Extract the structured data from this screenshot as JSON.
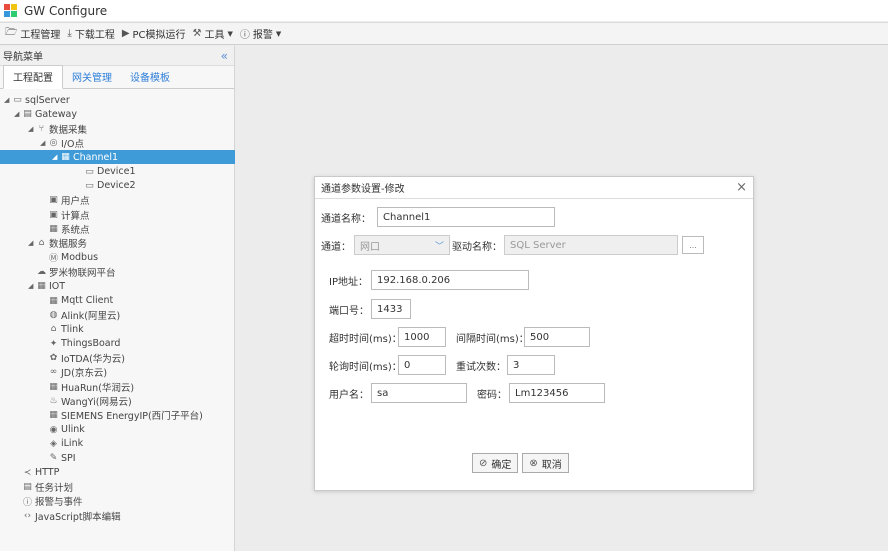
{
  "app": {
    "title": "GW Configure"
  },
  "toolbar": {
    "items": [
      {
        "label": "工程管理",
        "icon": "folder-icon"
      },
      {
        "label": "下载工程",
        "icon": "download-icon"
      },
      {
        "label": "PC模拟运行",
        "icon": "play-icon"
      },
      {
        "label": "工具",
        "icon": "wrench-icon"
      },
      {
        "label": "报警",
        "icon": "alarm-icon"
      }
    ]
  },
  "sidebar": {
    "title": "导航菜单",
    "collapse_glyph": "«",
    "tabs": [
      "工程配置",
      "网关管理",
      "设备模板"
    ],
    "active_tab": 0,
    "tree": [
      {
        "label": "sqlServer",
        "level": 0,
        "arrow": "◢",
        "icon": "monitor-icon"
      },
      {
        "label": "Gateway",
        "level": 1,
        "arrow": "◢",
        "icon": "gateway-icon"
      },
      {
        "label": "数据采集",
        "level": 2,
        "arrow": "◢",
        "icon": "collect-icon"
      },
      {
        "label": "I/O点",
        "level": 3,
        "arrow": "◢",
        "icon": "io-icon"
      },
      {
        "label": "Channel1",
        "level": 4,
        "arrow": "◢",
        "icon": "channel-icon",
        "selected": true
      },
      {
        "label": "Device1",
        "level": 5,
        "arrow": "",
        "icon": "device-icon"
      },
      {
        "label": "Device2",
        "level": 5,
        "arrow": "",
        "icon": "device-icon"
      },
      {
        "label": "用户点",
        "level": 3,
        "arrow": "",
        "icon": "user-point-icon"
      },
      {
        "label": "计算点",
        "level": 3,
        "arrow": "",
        "icon": "calc-point-icon"
      },
      {
        "label": "系统点",
        "level": 3,
        "arrow": "",
        "icon": "system-point-icon"
      },
      {
        "label": "数据服务",
        "level": 2,
        "arrow": "◢",
        "icon": "data-service-icon"
      },
      {
        "label": "Modbus",
        "level": 3,
        "arrow": "",
        "icon": "modbus-icon"
      },
      {
        "label": "罗米物联网平台",
        "level": 2,
        "arrow": "",
        "icon": "cloud-icon"
      },
      {
        "label": "IOT",
        "level": 2,
        "arrow": "◢",
        "icon": "iot-icon"
      },
      {
        "label": "Mqtt Client",
        "level": 3,
        "arrow": "",
        "icon": "mqtt-icon"
      },
      {
        "label": "Alink(阿里云)",
        "level": 3,
        "arrow": "",
        "icon": "alink-icon"
      },
      {
        "label": "Tlink",
        "level": 3,
        "arrow": "",
        "icon": "tlink-icon"
      },
      {
        "label": "ThingsBoard",
        "level": 3,
        "arrow": "",
        "icon": "thingsboard-icon"
      },
      {
        "label": "IoTDA(华为云)",
        "level": 3,
        "arrow": "",
        "icon": "iotda-icon"
      },
      {
        "label": "JD(京东云)",
        "level": 3,
        "arrow": "",
        "icon": "jd-icon"
      },
      {
        "label": "HuaRun(华润云)",
        "level": 3,
        "arrow": "",
        "icon": "huarun-icon"
      },
      {
        "label": "WangYi(网易云)",
        "level": 3,
        "arrow": "",
        "icon": "wangyi-icon"
      },
      {
        "label": "SIEMENS EnergyIP(西门子平台)",
        "level": 3,
        "arrow": "",
        "icon": "siemens-icon"
      },
      {
        "label": "Ulink",
        "level": 3,
        "arrow": "",
        "icon": "ulink-icon"
      },
      {
        "label": "iLink",
        "level": 3,
        "arrow": "",
        "icon": "ilink-icon"
      },
      {
        "label": "SPI",
        "level": 3,
        "arrow": "",
        "icon": "spi-icon"
      },
      {
        "label": "HTTP",
        "level": 1,
        "arrow": "",
        "icon": "share-icon"
      },
      {
        "label": "任务计划",
        "level": 1,
        "arrow": "",
        "icon": "task-icon"
      },
      {
        "label": "报警与事件",
        "level": 1,
        "arrow": "",
        "icon": "alarm-icon"
      },
      {
        "label": "JavaScript脚本编辑",
        "level": 1,
        "arrow": "",
        "icon": "code-icon"
      }
    ]
  },
  "dialog": {
    "title": "通道参数设置-修改",
    "close_glyph": "×",
    "channel_name_label": "通道名称：",
    "channel_name_value": "Channel1",
    "channel_label": "通道：",
    "channel_value": "网口",
    "driver_label": "驱动名称：",
    "driver_value": "SQL Server",
    "driver_browse": "...",
    "ip_label": "IP地址：",
    "ip_value": "192.168.0.206",
    "port_label": "端口号：",
    "port_value": "1433",
    "timeout_label": "超时时间(ms)：",
    "timeout_value": "1000",
    "interval_label": "间隔时间(ms)：",
    "interval_value": "500",
    "poll_label": "轮询时间(ms)：",
    "poll_value": "0",
    "retry_label": "重试次数：",
    "retry_value": "3",
    "user_label": "用户名：",
    "user_value": "sa",
    "password_label": "密码：",
    "password_value": "Lm123456",
    "ok_label": "确定",
    "cancel_label": "取消"
  }
}
